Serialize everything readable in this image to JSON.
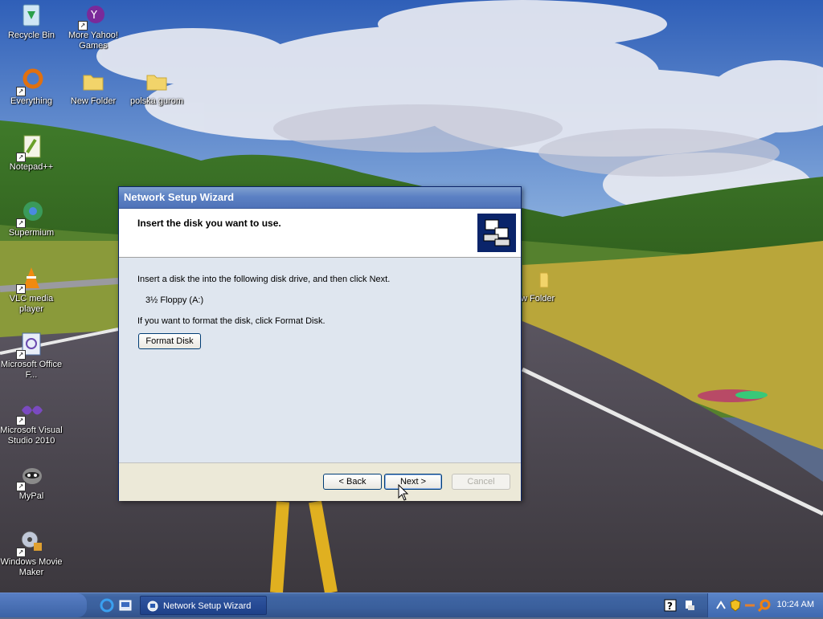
{
  "desktop": {
    "icons": [
      {
        "label": "Recycle Bin"
      },
      {
        "label": "More Yahoo! Games"
      },
      {
        "label": "Everything"
      },
      {
        "label": "New Folder"
      },
      {
        "label": "polska gurom"
      },
      {
        "label": "Notepad++"
      },
      {
        "label": "Supermium"
      },
      {
        "label": "VLC media player"
      },
      {
        "label": "Microsoft Office F..."
      },
      {
        "label": "Microsoft Visual Studio 2010"
      },
      {
        "label": "MyPal"
      },
      {
        "label": "Windows Movie Maker"
      },
      {
        "label": "w Folder"
      }
    ]
  },
  "wizard": {
    "title": "Network Setup Wizard",
    "heading": "Insert the disk you want to use.",
    "instruction": "Insert a disk the into the following disk drive, and then click Next.",
    "drive": "3½ Floppy (A:)",
    "format_hint": "If you want to format the disk, click Format Disk.",
    "format_button": "Format Disk",
    "back_button": "< Back",
    "next_button": "Next >",
    "cancel_button": "Cancel"
  },
  "taskbar": {
    "task_label": "Network Setup Wizard",
    "clock": "10:24 AM"
  },
  "colors": {
    "titlebar": "#5c81c4",
    "taskbar": "#3a5f9c",
    "dialog_body": "#dfe6ef"
  }
}
